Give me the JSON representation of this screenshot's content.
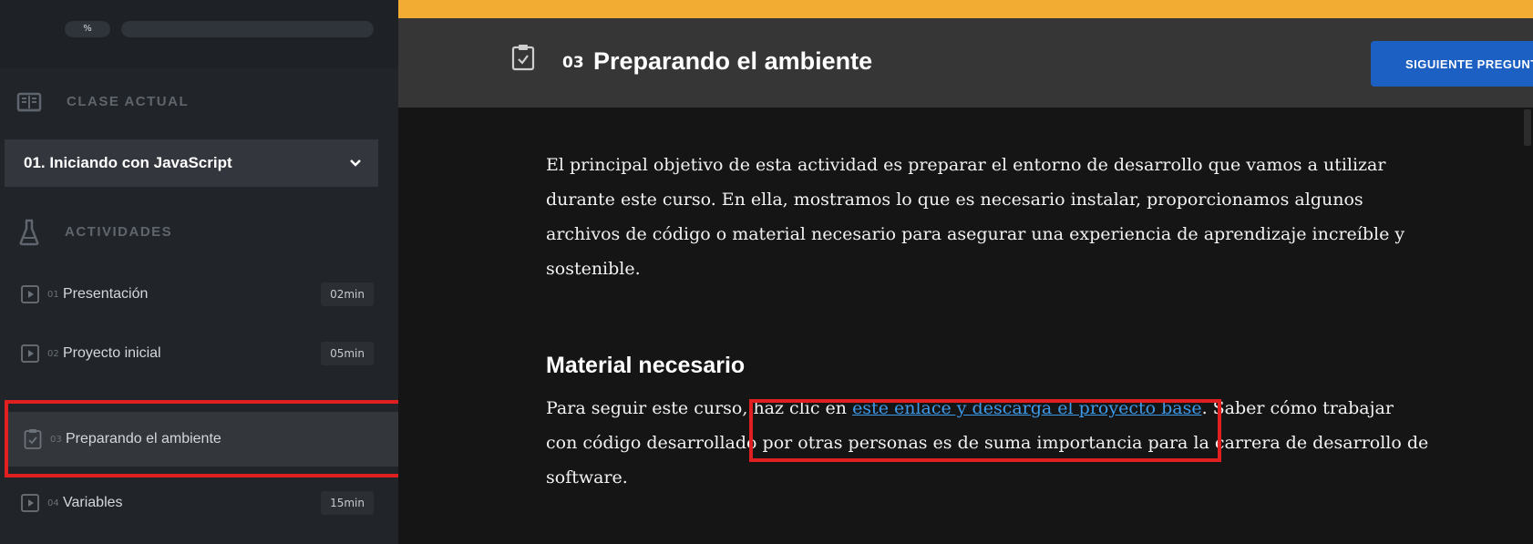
{
  "progress": {
    "percent_label": "%",
    "fraction": 0.0
  },
  "sidebar": {
    "current_class_label": "CLASE ACTUAL",
    "current_class": "01. Iniciando con JavaScript",
    "activities_label": "ACTIVIDADES",
    "activities": [
      {
        "num": "01",
        "title": "Presentación",
        "duration": "02min",
        "icon": "play-icon"
      },
      {
        "num": "02",
        "title": "Proyecto inicial",
        "duration": "05min",
        "icon": "play-icon"
      },
      {
        "num": "03",
        "title": "Preparando el ambiente",
        "duration": "",
        "icon": "clipboard-check-icon",
        "current": true
      },
      {
        "num": "04",
        "title": "Variables",
        "duration": "15min",
        "icon": "play-icon"
      }
    ]
  },
  "header": {
    "num": "03",
    "title": "Preparando el ambiente",
    "next_button_label": "SIGUIENTE PREGUNTA"
  },
  "content": {
    "intro": "El principal objetivo de esta actividad es preparar el entorno de desarrollo que vamos a utilizar durante este curso. En ella, mostramos lo que es necesario instalar, proporcionamos algunos archivos de código o material necesario para asegurar una experiencia de aprendizaje increíble y sostenible.",
    "heading": "Material necesario",
    "para2_before": "Para seguir este curso, haz clic en ",
    "para2_link": "este enlace y descarga el proyecto base",
    "para2_after": ". Saber cómo trabajar con código desarrollado por otras personas es de suma importancia para la carrera de desarrollo de software."
  },
  "colors": {
    "accent": "#f2ab33",
    "primary_button": "#1c60c4",
    "link": "#3d9ae8",
    "highlight": "#e02020"
  }
}
